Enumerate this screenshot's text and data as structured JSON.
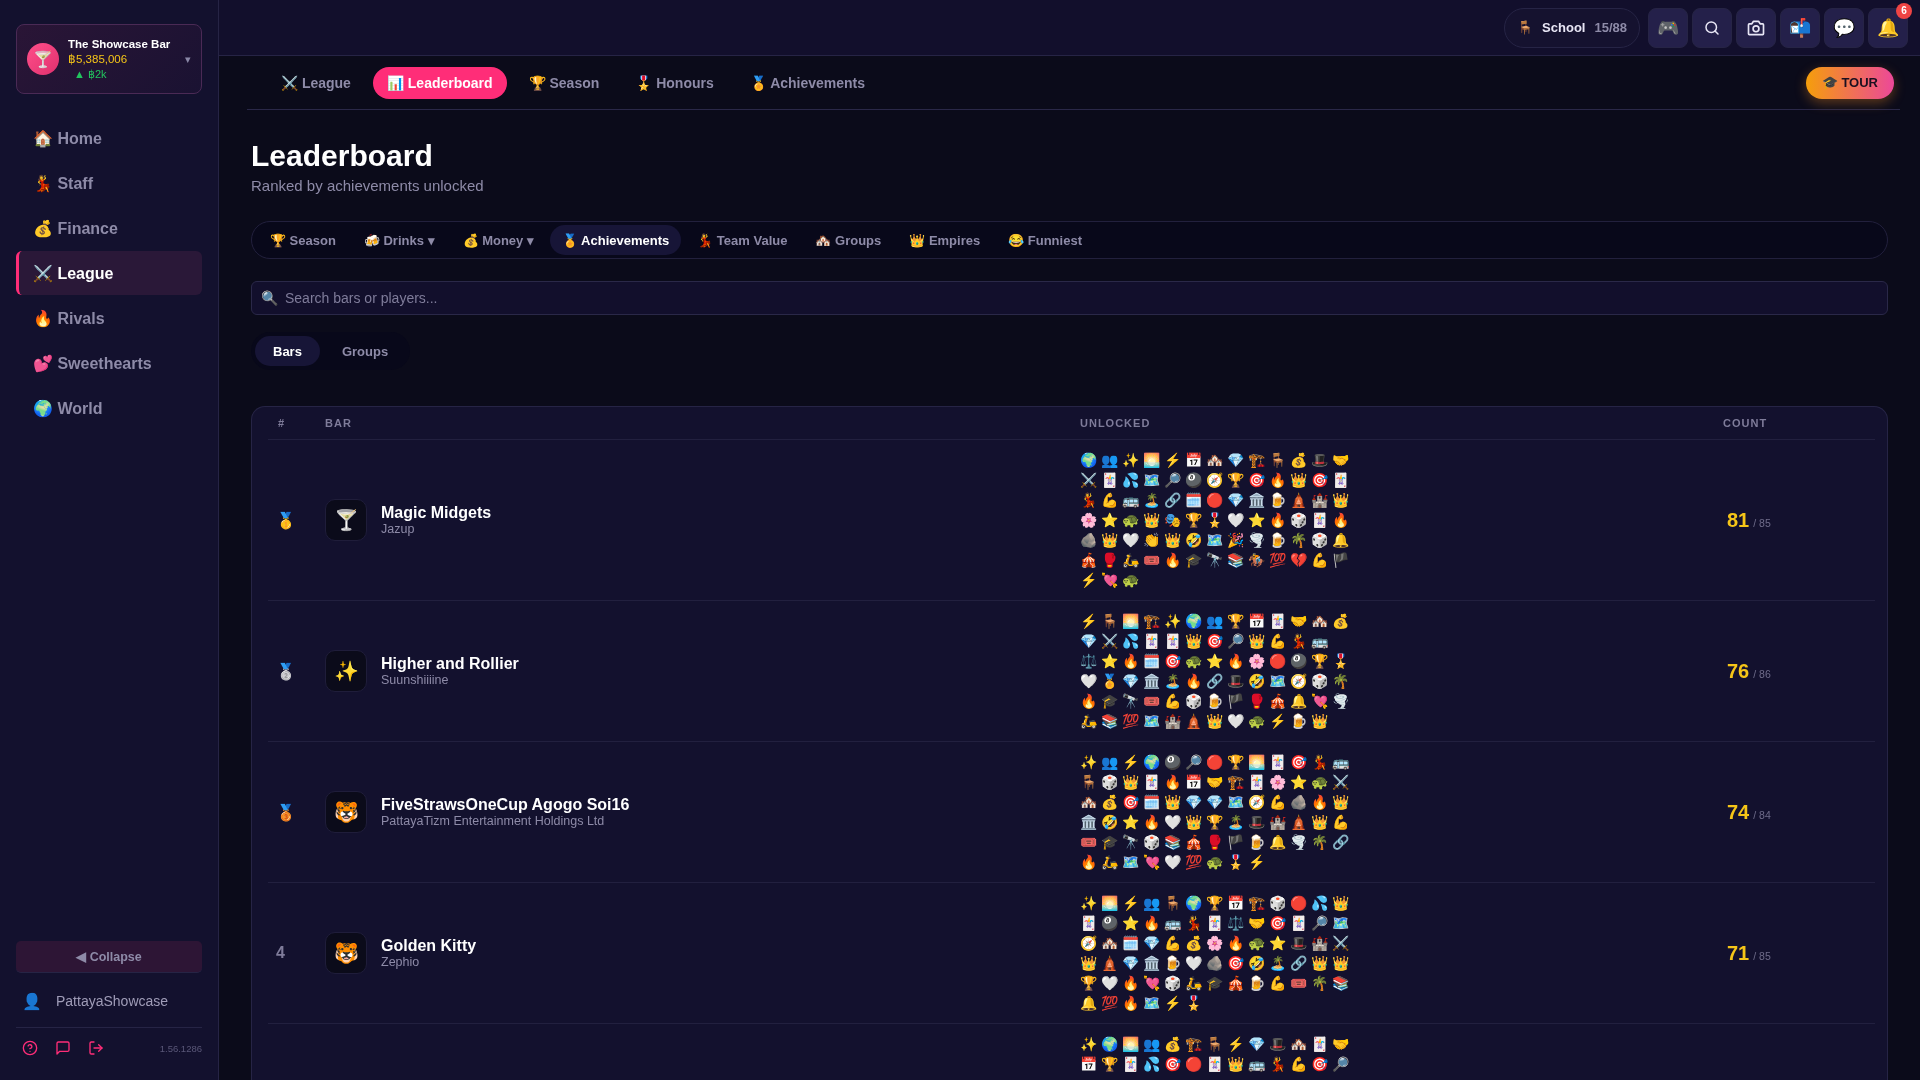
{
  "sidebar": {
    "bar": {
      "avatar": "🍸",
      "name": "The Showcase Bar",
      "balance": "฿5,385,006",
      "change": "▲ ฿2k",
      "caret": "▾"
    },
    "nav": [
      {
        "label": "🏠 Home",
        "selected": false
      },
      {
        "label": "💃 Staff",
        "selected": false
      },
      {
        "label": "💰 Finance",
        "selected": false
      },
      {
        "label": "⚔️ League",
        "selected": true
      },
      {
        "label": "🔥 Rivals",
        "selected": false
      },
      {
        "label": "💕 Sweethearts",
        "selected": false
      },
      {
        "label": "🌍 World",
        "selected": false
      }
    ],
    "collapse": "◀ Collapse",
    "user": {
      "icon": "👤",
      "name": "PattayaShowcase"
    },
    "version": "1.56.1286"
  },
  "topbar": {
    "school": {
      "icon": "🪑",
      "label": "School",
      "count": "15/88"
    },
    "icons": [
      {
        "kind": "emoji",
        "text": "🎮"
      },
      {
        "kind": "search"
      },
      {
        "kind": "camera"
      },
      {
        "kind": "emoji",
        "text": "📬"
      },
      {
        "kind": "emoji",
        "text": "💬"
      },
      {
        "kind": "emoji",
        "text": "🔔",
        "badge": "6"
      }
    ]
  },
  "tabs": [
    {
      "label": "⚔️ League",
      "selected": false
    },
    {
      "label": "📊 Leaderboard",
      "selected": true
    },
    {
      "label": "🏆 Season",
      "selected": false
    },
    {
      "label": "🎖️ Honours",
      "selected": false
    },
    {
      "label": "🏅 Achievements",
      "selected": false
    }
  ],
  "tour": "🎓 TOUR",
  "page": {
    "title": "Leaderboard",
    "subtitle": "Ranked by achievements unlocked"
  },
  "filters": [
    {
      "label": "🏆 Season",
      "selected": false
    },
    {
      "label": "🍻 Drinks ▾",
      "selected": false
    },
    {
      "label": "💰 Money ▾",
      "selected": false
    },
    {
      "label": "🏅 Achievements",
      "selected": true
    },
    {
      "label": "💃 Team Value",
      "selected": false
    },
    {
      "label": "🏘️ Groups",
      "selected": false
    },
    {
      "label": "👑 Empires",
      "selected": false
    },
    {
      "label": "😂 Funniest",
      "selected": false
    }
  ],
  "search": {
    "icon": "🔍",
    "placeholder": "Search bars or players..."
  },
  "views": [
    {
      "label": "Bars",
      "selected": true
    },
    {
      "label": "Groups",
      "selected": false
    }
  ],
  "table": {
    "columns": [
      "#",
      "BAR",
      "UNLOCKED",
      "COUNT"
    ],
    "rows": [
      {
        "rank": "🥇",
        "avatar": "🍸",
        "name": "Magic Midgets",
        "owner": "Jazup",
        "unlocked": "🌍👥✨🌅⚡📅🏘️💎🏗️🪑💰🎩🤝⚔️🃏💦🗺️🔎🎱🧭🏆🎯🔥👑🎯🃏💃💪🚌🏝️🔗🗓️🔴💎🏛️🍺🛕🏰👑🌸⭐🐢👑🎭🏆🎖️🤍⭐🔥🎲🃏🔥🪨👑🤍👏👑🤣🗺️🎉🌪️🍺🌴🎲🔔🎪🥊🛵🎟️🔥🎓🔭📚🏇💯💔💪🏴⚡💘🐢",
        "count": "81",
        "total": "/ 85"
      },
      {
        "rank": "🥈",
        "avatar": "✨",
        "name": "Higher and Rollier",
        "owner": "Suunshiiiine",
        "unlocked": "⚡🪑🌅🏗️✨🌍👥🏆📅🃏🤝🏘️💰💎⚔️💦🃏🃏👑🎯🔎👑💪💃🚌⚖️⭐🔥🗓️🎯🐢⭐🔥🌸🔴🎱🏆🎖️🤍🏅💎🏛️🏝️🔥🔗🎩🤣🗺️🧭🎲🌴🔥🎓🔭🎟️💪🎲🍺🏴🥊🎪🔔💘🌪️🛵📚💯🗺️🏰🛕👑🤍🐢⚡🍺👑",
        "count": "76",
        "total": "/ 86"
      },
      {
        "rank": "🥉",
        "avatar": "🐯",
        "name": "FiveStrawsOneCup Agogo Soi16",
        "owner": "PattayaTizm Entertainment Holdings Ltd",
        "unlocked": "✨👥⚡🌍🎱🔎🔴🏆🌅🃏🎯💃🚌🪑🎲👑🃏🔥📅🤝🏗️🃏🌸⭐🐢⚔️🏘️💰🎯🗓️👑💎💎🗺️🧭💪🪨🔥👑🏛️🤣⭐🔥🤍👑🏆🏝️🎩🏰🛕👑💪🎟️🎓🔭🎲📚🎪🥊🏴🍺🔔🌪️🌴🔗🔥🛵🗺️💘🤍💯🐢🎖️⚡",
        "count": "74",
        "total": "/ 84"
      },
      {
        "rank": "4",
        "avatar": "🐯",
        "name": "Golden Kitty",
        "owner": "Zephio",
        "unlocked": "✨🌅⚡👥🪑🌍🏆📅🏗️🎲🔴💦👑🃏🎱⭐🔥🚌💃🃏⚖️🤝🎯🃏🔎🗺️🧭🏘️🗓️💎💪💰🌸🔥🐢⭐🎩🏰⚔️👑🛕💎🏛️🍺🤍🪨🎯🤣🏝️🔗👑👑🏆🤍🔥💘🎲🛵🎓🎪🍺💪🎟️🌴📚🔔💯🔥🗺️⚡🎖️",
        "count": "71",
        "total": "/ 85"
      },
      {
        "unlocked": "✨🌍🌅👥💰🏗️🪑⚡💎🎩🏘️🃏🤝📅🏆🃏💦🎯🔴🃏👑🚌💃💪🎯🔎"
      }
    ]
  }
}
